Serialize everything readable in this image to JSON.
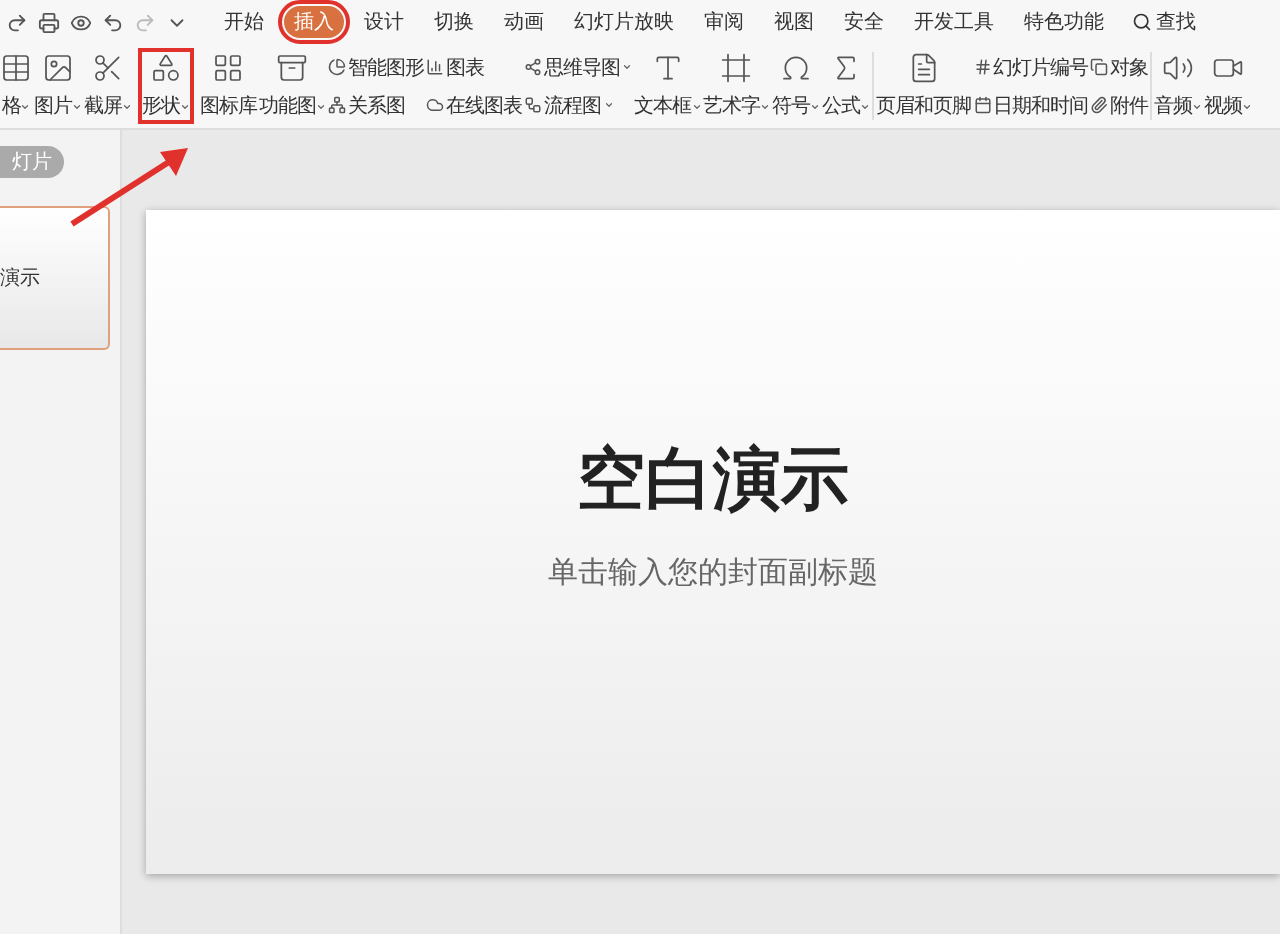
{
  "menu_tabs": [
    {
      "label": "开始",
      "selected": false,
      "highlighted": false
    },
    {
      "label": "插入",
      "selected": true,
      "highlighted": true
    },
    {
      "label": "设计",
      "selected": false,
      "highlighted": false
    },
    {
      "label": "切换",
      "selected": false,
      "highlighted": false
    },
    {
      "label": "动画",
      "selected": false,
      "highlighted": false
    },
    {
      "label": "幻灯片放映",
      "selected": false,
      "highlighted": false
    },
    {
      "label": "审阅",
      "selected": false,
      "highlighted": false
    },
    {
      "label": "视图",
      "selected": false,
      "highlighted": false
    },
    {
      "label": "安全",
      "selected": false,
      "highlighted": false
    },
    {
      "label": "开发工具",
      "selected": false,
      "highlighted": false
    },
    {
      "label": "特色功能",
      "selected": false,
      "highlighted": false
    }
  ],
  "search": {
    "label": "查找"
  },
  "ribbon": [
    {
      "kind": "large",
      "label": "格",
      "dropdown": true,
      "highlighted": false
    },
    {
      "kind": "large",
      "label": "图片",
      "dropdown": true,
      "highlighted": false
    },
    {
      "kind": "large",
      "label": "截屏",
      "dropdown": true,
      "highlighted": false
    },
    {
      "kind": "large",
      "label": "形状",
      "dropdown": true,
      "highlighted": true
    },
    {
      "kind": "large",
      "label": "图标库",
      "dropdown": false,
      "highlighted": false
    },
    {
      "kind": "large",
      "label": "功能图",
      "dropdown": true,
      "highlighted": false
    },
    {
      "kind": "stack",
      "items": [
        {
          "label": "智能图形",
          "dropdown": false
        },
        {
          "label": "关系图",
          "dropdown": false
        }
      ]
    },
    {
      "kind": "stack",
      "items": [
        {
          "label": "图表",
          "dropdown": false
        },
        {
          "label": "在线图表",
          "dropdown": false
        }
      ]
    },
    {
      "kind": "stack",
      "items": [
        {
          "label": "思维导图",
          "dropdown": true
        },
        {
          "label": "流程图",
          "dropdown": true
        }
      ]
    },
    {
      "kind": "large",
      "label": "文本框",
      "dropdown": true,
      "highlighted": false
    },
    {
      "kind": "large",
      "label": "艺术字",
      "dropdown": true,
      "highlighted": false
    },
    {
      "kind": "large",
      "label": "符号",
      "dropdown": true,
      "highlighted": false
    },
    {
      "kind": "large",
      "label": "公式",
      "dropdown": true,
      "highlighted": false
    },
    {
      "kind": "separator"
    },
    {
      "kind": "large",
      "label": "页眉和页脚",
      "dropdown": false,
      "highlighted": false
    },
    {
      "kind": "stack",
      "items": [
        {
          "label": "幻灯片编号",
          "dropdown": false
        },
        {
          "label": "日期和时间",
          "dropdown": false
        }
      ]
    },
    {
      "kind": "stack",
      "items": [
        {
          "label": "对象",
          "dropdown": false
        },
        {
          "label": "附件",
          "dropdown": false
        }
      ]
    },
    {
      "kind": "separator"
    },
    {
      "kind": "large",
      "label": "音频",
      "dropdown": true,
      "highlighted": false
    },
    {
      "kind": "large",
      "label": "视频",
      "dropdown": true,
      "highlighted": false
    }
  ],
  "sidebar": {
    "tab": "灯片",
    "thumbnail": {
      "title": "演示",
      "selected": true
    }
  },
  "slide": {
    "title": "空白演示",
    "subtitle": "单击输入您的封面副标题"
  }
}
